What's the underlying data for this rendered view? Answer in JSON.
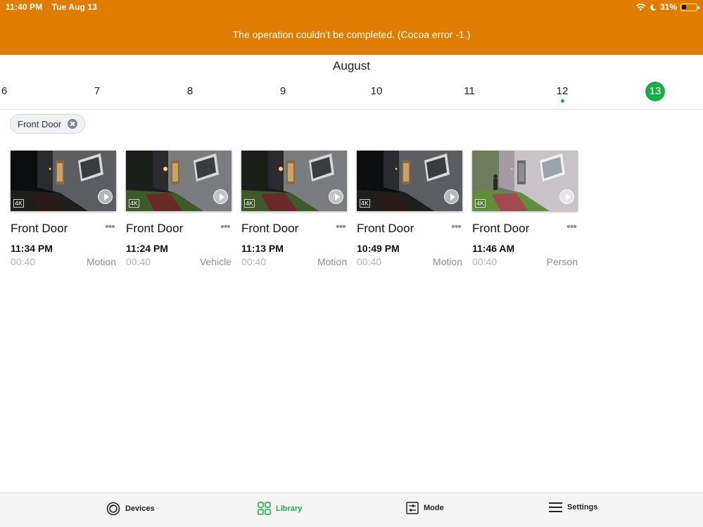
{
  "status_bar": {
    "time": "11:40 PM",
    "date": "Tue Aug 13",
    "battery": "31%",
    "battery_level": 0.31
  },
  "banner": {
    "message": "The operation couldn’t be completed. (Cocoa error -1.)",
    "color": "#e07c00"
  },
  "calendar": {
    "month": "August",
    "dates": [
      {
        "label": "6",
        "selected": false,
        "has_events": false
      },
      {
        "label": "7",
        "selected": false,
        "has_events": false
      },
      {
        "label": "8",
        "selected": false,
        "has_events": false
      },
      {
        "label": "9",
        "selected": false,
        "has_events": false
      },
      {
        "label": "10",
        "selected": false,
        "has_events": false
      },
      {
        "label": "11",
        "selected": false,
        "has_events": false
      },
      {
        "label": "12",
        "selected": false,
        "has_events": true
      },
      {
        "label": "13",
        "selected": true,
        "has_events": false
      }
    ],
    "accent_color": "#1aab4b"
  },
  "filter": {
    "chip_label": "Front Door"
  },
  "clips": [
    {
      "camera": "Front Door",
      "time": "11:34 PM",
      "duration": "00:40",
      "type": "Motion",
      "badge": "4K",
      "scene": "night"
    },
    {
      "camera": "Front Door",
      "time": "11:24 PM",
      "duration": "00:40",
      "type": "Vehicle",
      "badge": "4K",
      "scene": "night-lit"
    },
    {
      "camera": "Front Door",
      "time": "11:13 PM",
      "duration": "00:40",
      "type": "Motion",
      "badge": "4K",
      "scene": "night-lit"
    },
    {
      "camera": "Front Door",
      "time": "10:49 PM",
      "duration": "00:40",
      "type": "Motion",
      "badge": "4K",
      "scene": "night"
    },
    {
      "camera": "Front Door",
      "time": "11:46 AM",
      "duration": "00:40",
      "type": "Person",
      "badge": "4K",
      "scene": "day"
    }
  ],
  "tabs": [
    {
      "label": "Devices",
      "icon": "camera-icon",
      "active": false
    },
    {
      "label": "Library",
      "icon": "grid-icon",
      "active": true
    },
    {
      "label": "Mode",
      "icon": "sliders-icon",
      "active": false
    },
    {
      "label": "Settings",
      "icon": "menu-icon",
      "active": false
    }
  ]
}
